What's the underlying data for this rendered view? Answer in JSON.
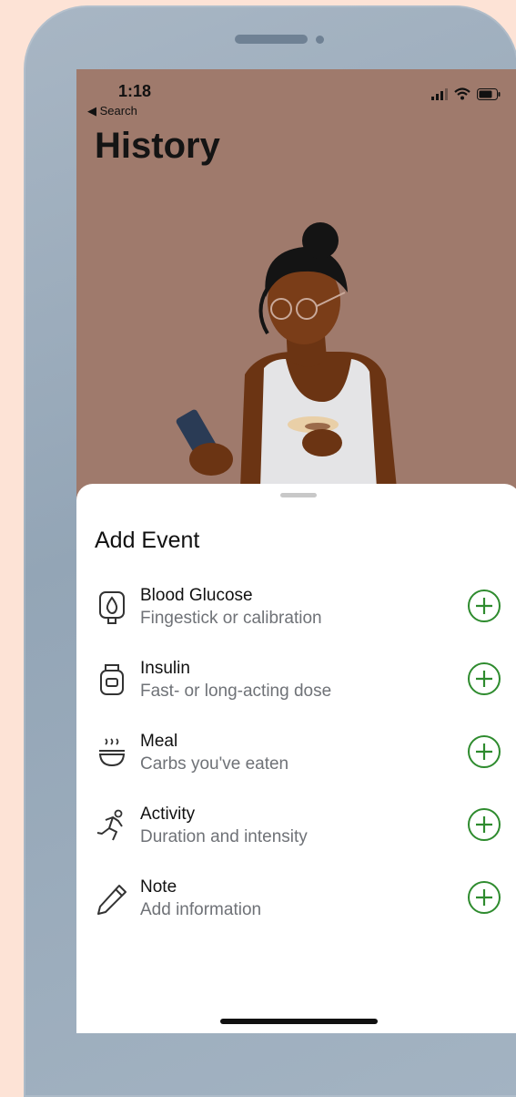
{
  "status": {
    "time": "1:18",
    "back": "◀ Search"
  },
  "page": {
    "title": "History"
  },
  "sheet": {
    "title": "Add Event",
    "items": [
      {
        "label": "Blood Glucose",
        "sub": "Fingestick or calibration",
        "icon": "blood-drop-meter-icon"
      },
      {
        "label": "Insulin",
        "sub": "Fast- or long-acting dose",
        "icon": "insulin-vial-icon"
      },
      {
        "label": "Meal",
        "sub": "Carbs you've eaten",
        "icon": "meal-bowl-icon"
      },
      {
        "label": "Activity",
        "sub": "Duration and intensity",
        "icon": "running-person-icon"
      },
      {
        "label": "Note",
        "sub": "Add information",
        "icon": "pencil-icon"
      }
    ]
  },
  "colors": {
    "accent": "#2e8b2e",
    "screen_bg": "#9f7a6c",
    "page_bg": "#fde3d6"
  }
}
